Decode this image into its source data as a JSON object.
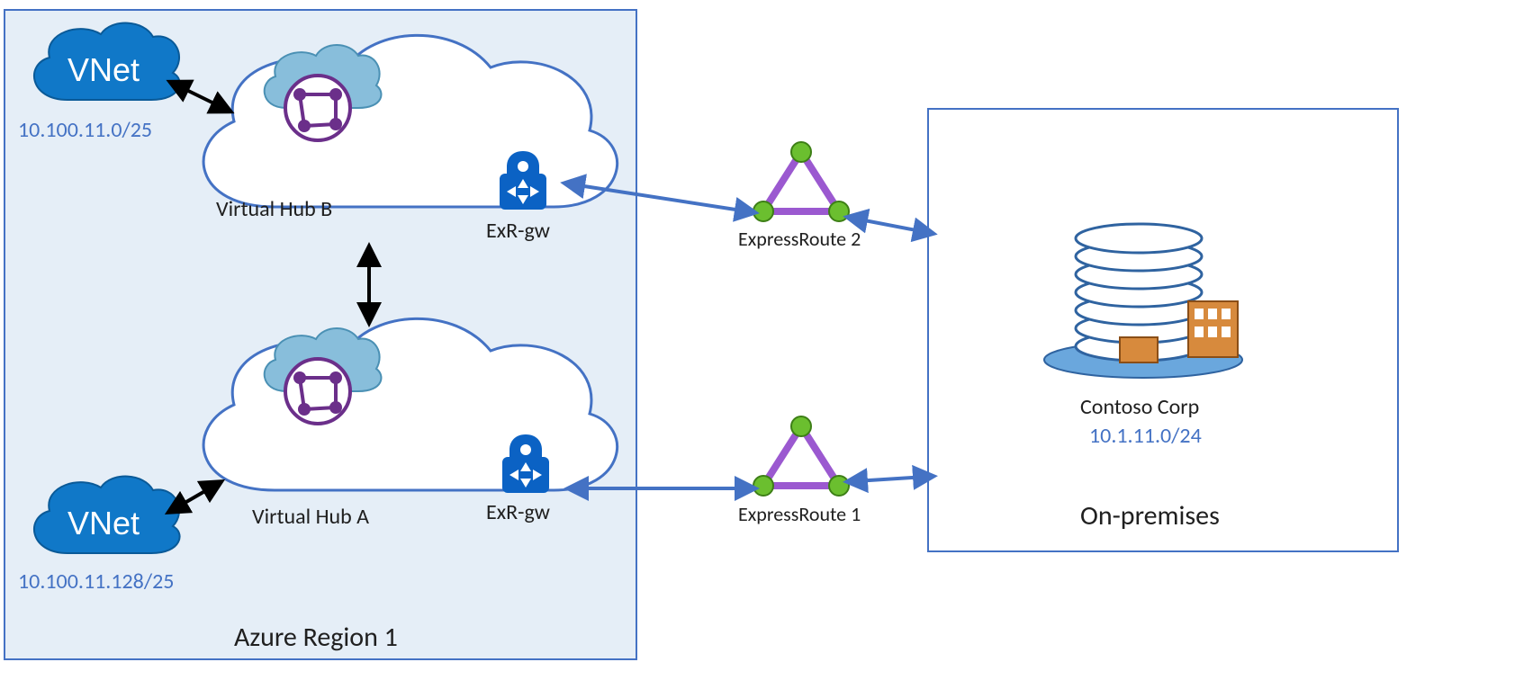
{
  "region": {
    "title": "Azure Region 1",
    "vnet_top": {
      "label": "VNet",
      "cidr": "10.100.11.0/25"
    },
    "vnet_bottom": {
      "label": "VNet",
      "cidr": "10.100.11.128/25"
    },
    "hub_b": {
      "label": "Virtual Hub B",
      "gw": "ExR-gw"
    },
    "hub_a": {
      "label": "Virtual Hub A",
      "gw": "ExR-gw"
    }
  },
  "expressroute": {
    "top": "ExpressRoute 2",
    "bottom": "ExpressRoute 1"
  },
  "onprem": {
    "name": "Contoso Corp",
    "cidr": "10.1.11.0/24",
    "label": "On-premises"
  }
}
